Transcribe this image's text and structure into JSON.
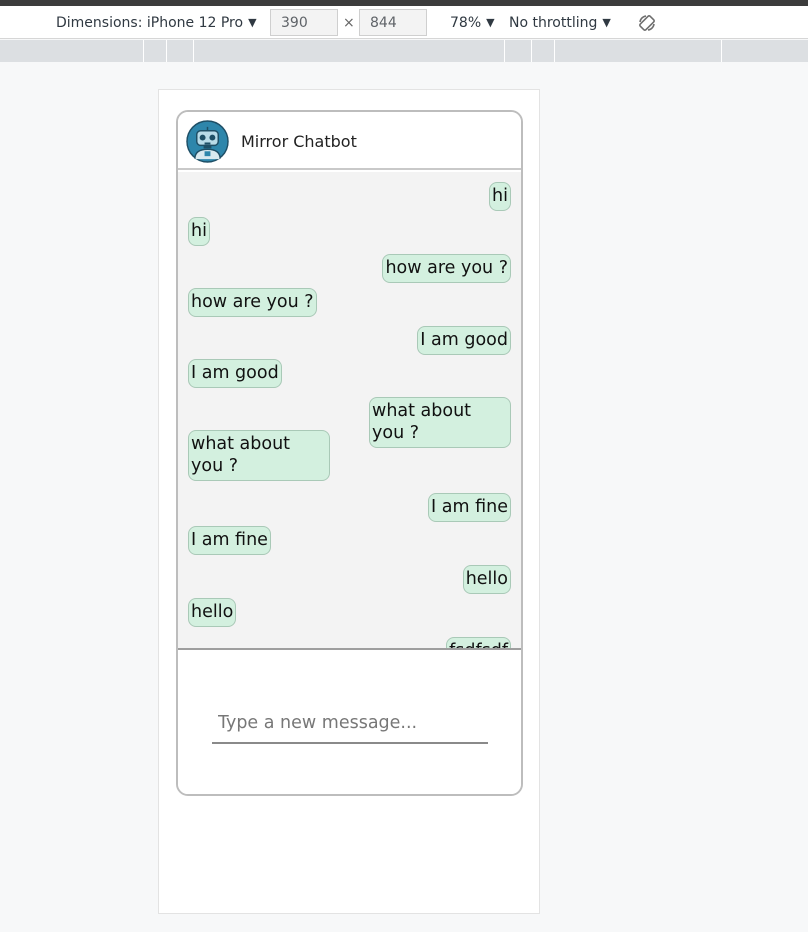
{
  "devtools": {
    "device_label": "Dimensions: iPhone 12 Pro",
    "width": "390",
    "times": "×",
    "height": "844",
    "zoom": "78%",
    "throttling": "No throttling",
    "caret": "▼",
    "rotate_icon": "rotate-icon"
  },
  "chat": {
    "title": "Mirror Chatbot",
    "avatar_icon": "robot-icon",
    "messages": [
      {
        "from": "user",
        "text": "hi"
      },
      {
        "from": "bot",
        "text": "hi"
      },
      {
        "from": "user",
        "text": "how are you ?"
      },
      {
        "from": "bot",
        "text": "how are you ?"
      },
      {
        "from": "user",
        "text": "I am good"
      },
      {
        "from": "bot",
        "text": "I am good"
      },
      {
        "from": "user",
        "text": "what about you ?"
      },
      {
        "from": "bot",
        "text": "what about you ?"
      },
      {
        "from": "user",
        "text": "I am fine"
      },
      {
        "from": "bot",
        "text": "I am fine"
      },
      {
        "from": "user",
        "text": "hello"
      },
      {
        "from": "bot",
        "text": "hello"
      },
      {
        "from": "user",
        "text": "fsdfsdf"
      }
    ],
    "input_placeholder": "Type a new message...",
    "colors": {
      "bubble": "#d3f0df",
      "bubble_border": "#a9c9b7",
      "messages_bg": "#f3f3f3",
      "avatar": "#2e86ab"
    }
  }
}
